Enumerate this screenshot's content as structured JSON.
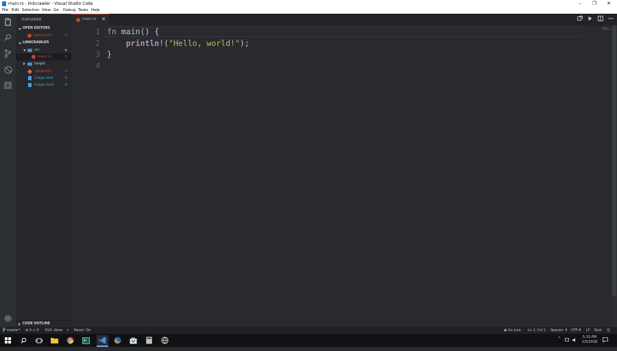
{
  "window": {
    "title": "main.rs - linkcrawler - Visual Studio Code",
    "minimize": "–",
    "restore": "❐",
    "close": "✕"
  },
  "menu": [
    "File",
    "Edit",
    "Selection",
    "View",
    "Go",
    "Debug",
    "Tasks",
    "Help"
  ],
  "sidebar": {
    "header": "EXPLORER",
    "open_editors_title": "OPEN EDITORS",
    "open_editors": [
      {
        "name": "main.rs",
        "path": "src",
        "badge": "U"
      }
    ],
    "project_title": "LINKCRAWLER",
    "tree": [
      {
        "name": "src",
        "badge": "●",
        "type": "folder-open"
      },
      {
        "name": "main.rs",
        "badge": "U",
        "type": "rust"
      },
      {
        "name": "target",
        "badge": "",
        "type": "folder"
      },
      {
        "name": ".gitignore",
        "badge": "U",
        "type": "git"
      },
      {
        "name": "Cargo.lock",
        "badge": "U",
        "type": "file"
      },
      {
        "name": "Cargo.toml",
        "badge": "U",
        "type": "file"
      }
    ],
    "outline_title": "CODE OUTLINE"
  },
  "tabs": [
    {
      "name": "main.rs",
      "close": "✕"
    }
  ],
  "editor": {
    "line_numbers": [
      "1",
      "2",
      "3",
      "4"
    ],
    "lines": [
      {
        "kw": "fn",
        "rest": " main() {"
      },
      {
        "indent": "    ",
        "macro": "println!",
        "open": "(",
        "string": "\"Hello, world!\"",
        "close": ");"
      },
      {
        "text": "}"
      },
      {
        "text": ""
      }
    ]
  },
  "statusbar": {
    "branch": "master*",
    "problems": "⊗ 0 ⚠ 0",
    "rls": "RLS: done",
    "racer": "Racer: On",
    "go_live": "Go Live",
    "position": "Ln 1, Col 1",
    "spaces": "Spaces: 4",
    "encoding": "UTF-8",
    "eol": "LF",
    "language": "Rust"
  },
  "taskbar": {
    "time": "5:33 PM",
    "date": "1/5/2018"
  }
}
